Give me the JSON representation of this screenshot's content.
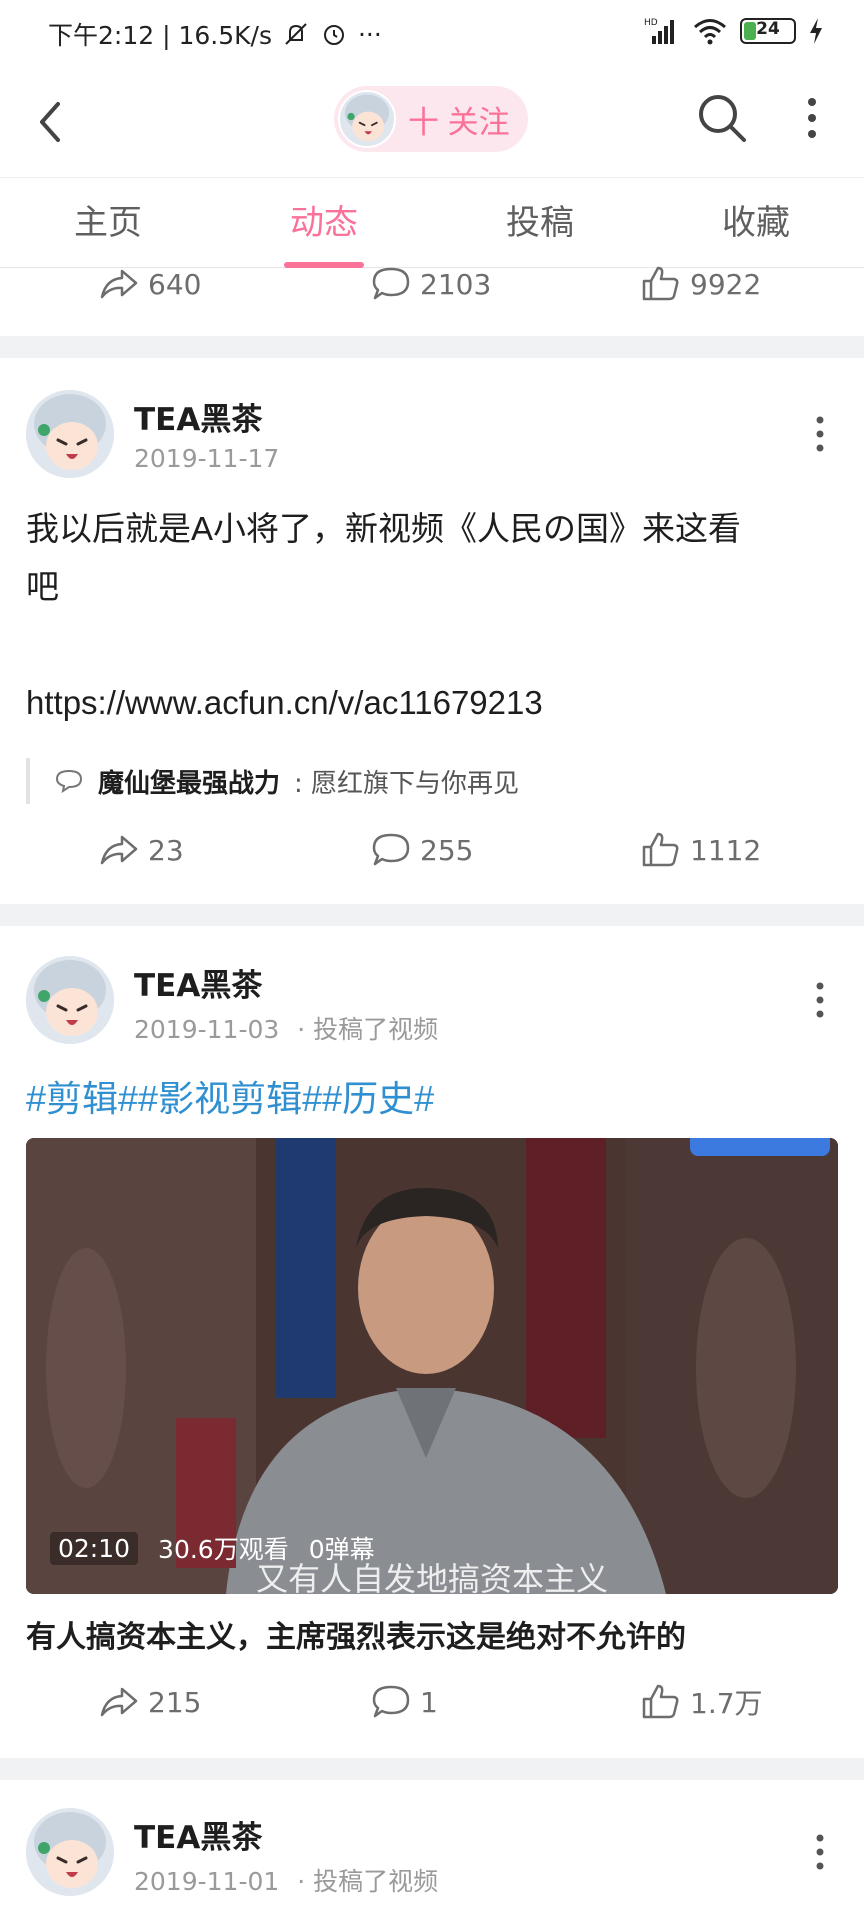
{
  "status_bar": {
    "time_speed": "下午2:12 | 16.5K/s",
    "more": "···",
    "network": "HD",
    "battery": "24",
    "battery_level": 0.24
  },
  "top_nav": {
    "follow_label": "十 关注"
  },
  "tabs": [
    {
      "label": "主页"
    },
    {
      "label": "动态"
    },
    {
      "label": "投稿"
    },
    {
      "label": "收藏"
    }
  ],
  "active_tab": 1,
  "colors": {
    "accent": "#fb7299",
    "link": "#2f8fd0",
    "divider": "#f1f2f3"
  },
  "prev_post": {
    "shares": "640",
    "comments": "2103",
    "likes": "9922"
  },
  "posts": [
    {
      "author": "TEA黑茶",
      "date": "2019-11-17",
      "text_line1": "我以后就是A小将了，新视频《人民の国》来这看",
      "text_line2": "吧",
      "link": "https://www.acfun.cn/v/ac11679213",
      "comment_name": "魔仙堡最强战力",
      "comment_text": ": 愿红旗下与你再见",
      "shares": "23",
      "comments": "255",
      "likes": "1112"
    },
    {
      "author": "TEA黑茶",
      "date": "2019-11-03",
      "action": "· 投稿了视频",
      "tags": "#剪辑##影视剪辑##历史#",
      "video_duration": "02:10",
      "video_views": "30.6万观看",
      "video_danmaku": "0弹幕",
      "video_subtitle": "又有人自发地搞资本主义",
      "video_title": "有人搞资本主义，主席强烈表示这是绝对不允许的",
      "shares": "215",
      "comments": "1",
      "likes": "1.7万"
    },
    {
      "author": "TEA黑茶",
      "date": "2019-11-01",
      "action": "· 投稿了视频"
    }
  ]
}
